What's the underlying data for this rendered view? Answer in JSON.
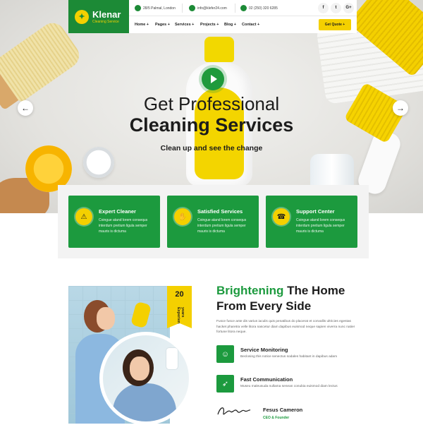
{
  "header": {
    "logo_name": "Klenar",
    "logo_tagline": "Cleaning Service",
    "address": "28/5 Palmal, London",
    "email": "info@klefer24.com",
    "phone": "02 (250) 320 6285",
    "social": [
      "f",
      "t",
      "G+"
    ],
    "nav": [
      "Home +",
      "Pages +",
      "Services +",
      "Projects +",
      "Blog +",
      "Contact +"
    ],
    "cta_label": "Get Quote +"
  },
  "hero": {
    "title_line1": "Get Professional",
    "title_line2": "Cleaning Services",
    "subtitle": "Clean up and see the change",
    "prev_arrow": "←",
    "next_arrow": "→"
  },
  "features": [
    {
      "icon": "shield-icon",
      "title": "Expert Cleaner",
      "text": "Coingue atand lorem consequs interdum pretium ligula semper mauris is dictuma"
    },
    {
      "icon": "handshake-icon",
      "title": "Satisfied Services",
      "text": "Coingue atand lorem consequs interdum pretium ligula semper mauris is dictuma"
    },
    {
      "icon": "headset-icon",
      "title": "Support Center",
      "text": "Coingue atand lorem consequs interdum pretium ligula semper mauris is dictuma"
    }
  ],
  "about": {
    "experience_number": "20",
    "experience_label": "years Experience",
    "title_highlight": "Brightening",
    "title_rest": " The Home",
    "title_line2": "From Every Side",
    "paragraph": "Fusce fusce ante dis varius iaculis quis penatibus do placerat et convallis ultricies egestas hacket pharetra velle litora nascetur diam dapibus euismod neque sapien viverra nunc natier fortune litora neque.",
    "services": [
      {
        "icon": "smiley-icon",
        "title": "Service Monitoring",
        "text": "Beclosing this notice senectus sodales habitant in dapibus adam"
      },
      {
        "icon": "rocket-icon",
        "title": "Fast Communication",
        "text": "Museu maleusuda nullama senean conubia euismod diam lectus"
      }
    ],
    "founder_name": "Fesus Cameron",
    "founder_role": "CEO & Founder"
  },
  "colors": {
    "brand_green": "#1c9a3e",
    "accent_yellow": "#f4d000",
    "text_dark": "#1c1c1c"
  }
}
